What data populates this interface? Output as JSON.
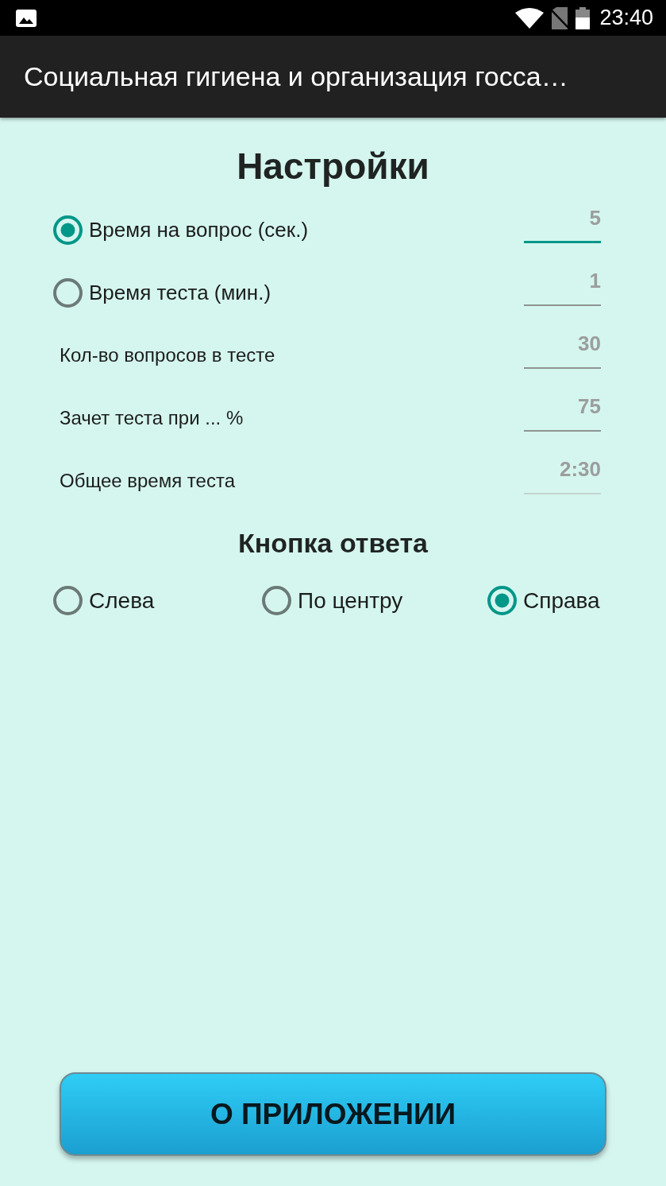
{
  "status_bar": {
    "time": "23:40"
  },
  "app_bar": {
    "title": "Социальная гигиена и организация госса…"
  },
  "settings": {
    "title": "Настройки",
    "rows": [
      {
        "kind": "radio",
        "label": "Время на вопрос (сек.)",
        "selected": true,
        "value": "5",
        "focused": true,
        "disabled": false
      },
      {
        "kind": "radio",
        "label": "Время теста (мин.)",
        "selected": false,
        "value": "1",
        "focused": false,
        "disabled": false
      },
      {
        "kind": "text",
        "label": "Кол-во вопросов в тесте",
        "value": "30",
        "focused": false,
        "disabled": false
      },
      {
        "kind": "text",
        "label": "Зачет теста при ... %",
        "value": "75",
        "focused": false,
        "disabled": false
      },
      {
        "kind": "text",
        "label": "Общее время теста",
        "value": "2:30",
        "focused": false,
        "disabled": true
      }
    ]
  },
  "answer_button": {
    "title": "Кнопка ответа",
    "options": [
      {
        "label": "Слева",
        "selected": false
      },
      {
        "label": "По центру",
        "selected": false
      },
      {
        "label": "Справа",
        "selected": true
      }
    ]
  },
  "about_button": {
    "label": "О ПРИЛОЖЕНИИ"
  }
}
